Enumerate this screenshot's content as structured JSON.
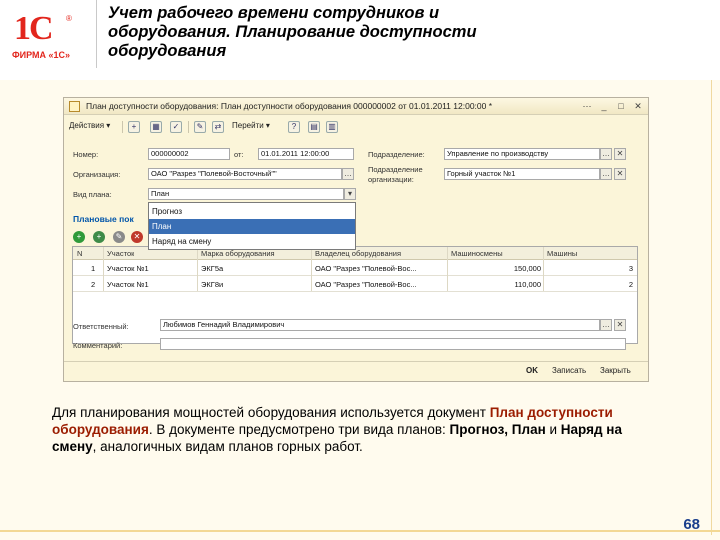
{
  "slide": {
    "logo_text": "1С",
    "logo_registered": "®",
    "logo_caption": "ФИРМА «1С»",
    "title": "Учет рабочего времени сотрудников и оборудования. Планирование доступности оборудования",
    "description_parts": [
      "Для планирования мощностей оборудования используется документ ",
      "План доступности оборудования",
      ". В документе предусмотрено три вида планов: ",
      "Прогноз, План",
      " и ",
      "Наряд на смену",
      ", аналогичных видам планов горных работ."
    ],
    "page_number": "68"
  },
  "window": {
    "title": "План доступности оборудования: План доступности оборудования 000000002 от 01.01.2011 12:00:00 *",
    "controls": [
      "⋯",
      "_",
      "□",
      "✕"
    ],
    "toolbar": {
      "actions_label": "Действия ▾",
      "goto_label": "Перейти ▾",
      "help": "?"
    },
    "form": {
      "number_label": "Номер:",
      "number_value": "000000002",
      "date_label": "от:",
      "date_value": "01.01.2011 12:00:00",
      "org_label": "Организация:",
      "org_value": "ОАО \"Разрез \"Полевой-Восточный\"\"",
      "plan_type_label": "Вид плана:",
      "plan_type_value": "План",
      "dept_label": "Подразделение:",
      "dept_value": "Управление по производству",
      "dept_org_label_1": "Подразделение",
      "dept_org_label_2": "организации:",
      "dept_org_value": "Горный участок №1",
      "section_title": "Плановые пок",
      "responsible_label": "Ответственный:",
      "responsible_value": "Любимов Геннадий Владимирович",
      "comment_label": "Комментарий:",
      "comment_value": ""
    },
    "dropdown_options": [
      "Прогноз",
      "План",
      "Наряд на смену"
    ],
    "dropdown_selected_index": 1,
    "grid": {
      "headers": [
        "N",
        "Участок",
        "Марка оборудования",
        "Владелец оборудования",
        "Машиносмены",
        "Машины"
      ],
      "rows": [
        [
          "1",
          "Участок №1",
          "ЭКГ5а",
          "ОАО \"Разрез \"Полевой-Вос...",
          "150,000",
          "3"
        ],
        [
          "2",
          "Участок №1",
          "ЭКГ8и",
          "ОАО \"Разрез \"Полевой-Вос...",
          "110,000",
          "2"
        ]
      ]
    },
    "footer": {
      "ok_label": "OK",
      "save_label": "Записать",
      "close_label": "Закрыть"
    }
  }
}
